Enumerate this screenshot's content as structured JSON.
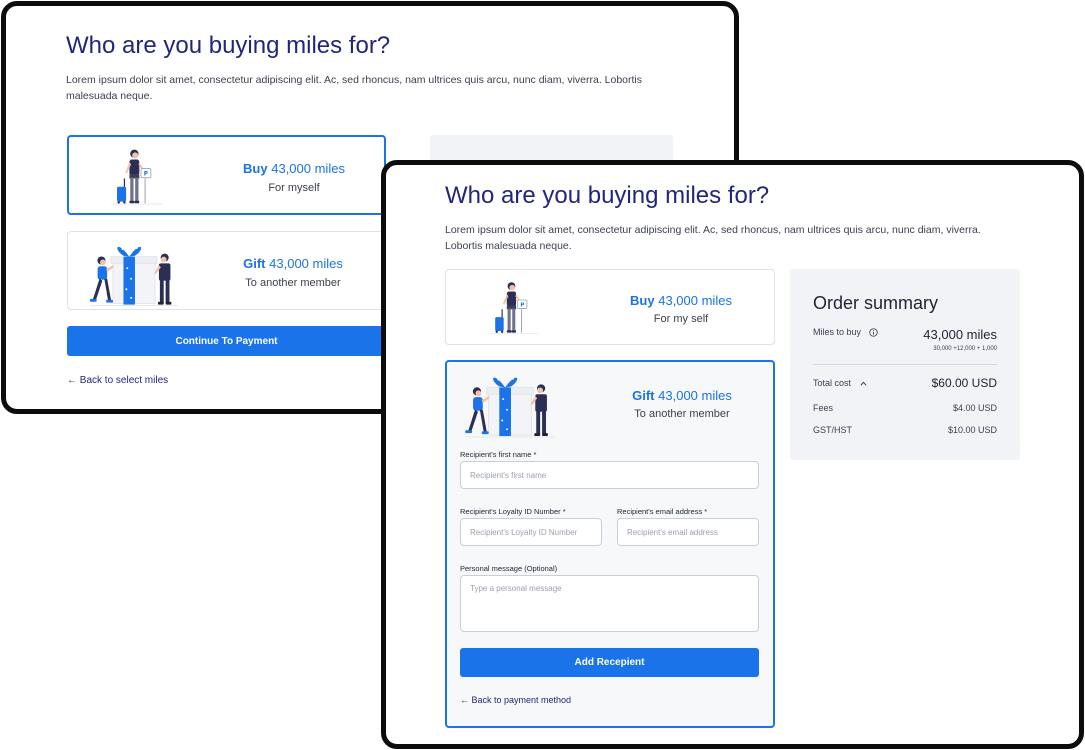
{
  "page": {
    "title": "Who are you buying miles for?",
    "description": "Lorem ipsum dolor sit amet, consectetur adipiscing elit. Ac, sed rhoncus, nam ultrices quis arcu, nunc diam, viverra. Lobortis malesuada neque."
  },
  "back_screen": {
    "buy_option": {
      "bold": "Buy",
      "miles": "43,000 miles",
      "subtitle": "For  myself"
    },
    "gift_option": {
      "bold": "Gift",
      "miles": "43,000 miles",
      "subtitle": "To another member"
    },
    "continue_label": "Continue To Payment",
    "back_label": "← Back to select miles"
  },
  "front_screen": {
    "buy_option": {
      "bold": "Buy",
      "miles": "43,000 miles",
      "subtitle": "For  my self"
    },
    "gift_option": {
      "bold": "Gift",
      "miles": "43,000 miles",
      "subtitle": "To another member"
    },
    "form": {
      "first_name": {
        "label": "Recipient's first name *",
        "placeholder": "Recipient's first name",
        "value": ""
      },
      "loyalty_id": {
        "label": "Recipient's Loyalty ID Number *",
        "placeholder": "Recipient's Loyalty ID Number",
        "value": ""
      },
      "email": {
        "label": "Recipient's email address *",
        "placeholder": "Recipient's email address",
        "value": ""
      },
      "message": {
        "label": "Personal message (Optional)",
        "placeholder": "Type a personal message",
        "value": ""
      },
      "submit_label": "Add Recepient"
    },
    "back_label": "← Back to payment method"
  },
  "order_summary": {
    "title": "Order summary",
    "miles_label": "Miles to buy",
    "miles_value": "43,000 miles",
    "miles_breakdown": "30,000 +12,000 + 1,000",
    "total_label": "Total cost",
    "total_value": "$60.00 USD",
    "fees_label": "Fees",
    "fees_value": "$4.00 USD",
    "gst_label": "GST/HST",
    "gst_value": "$10.00 USD"
  },
  "icons": {
    "info": "info-icon",
    "chevron": "chevron-up-icon",
    "traveler": "traveler-illustration",
    "gift": "gift-illustration"
  },
  "colors": {
    "heading": "#22267a",
    "accent": "#1a73e8",
    "panel": "#f1f3f6",
    "frame": "#0c0c0f"
  }
}
